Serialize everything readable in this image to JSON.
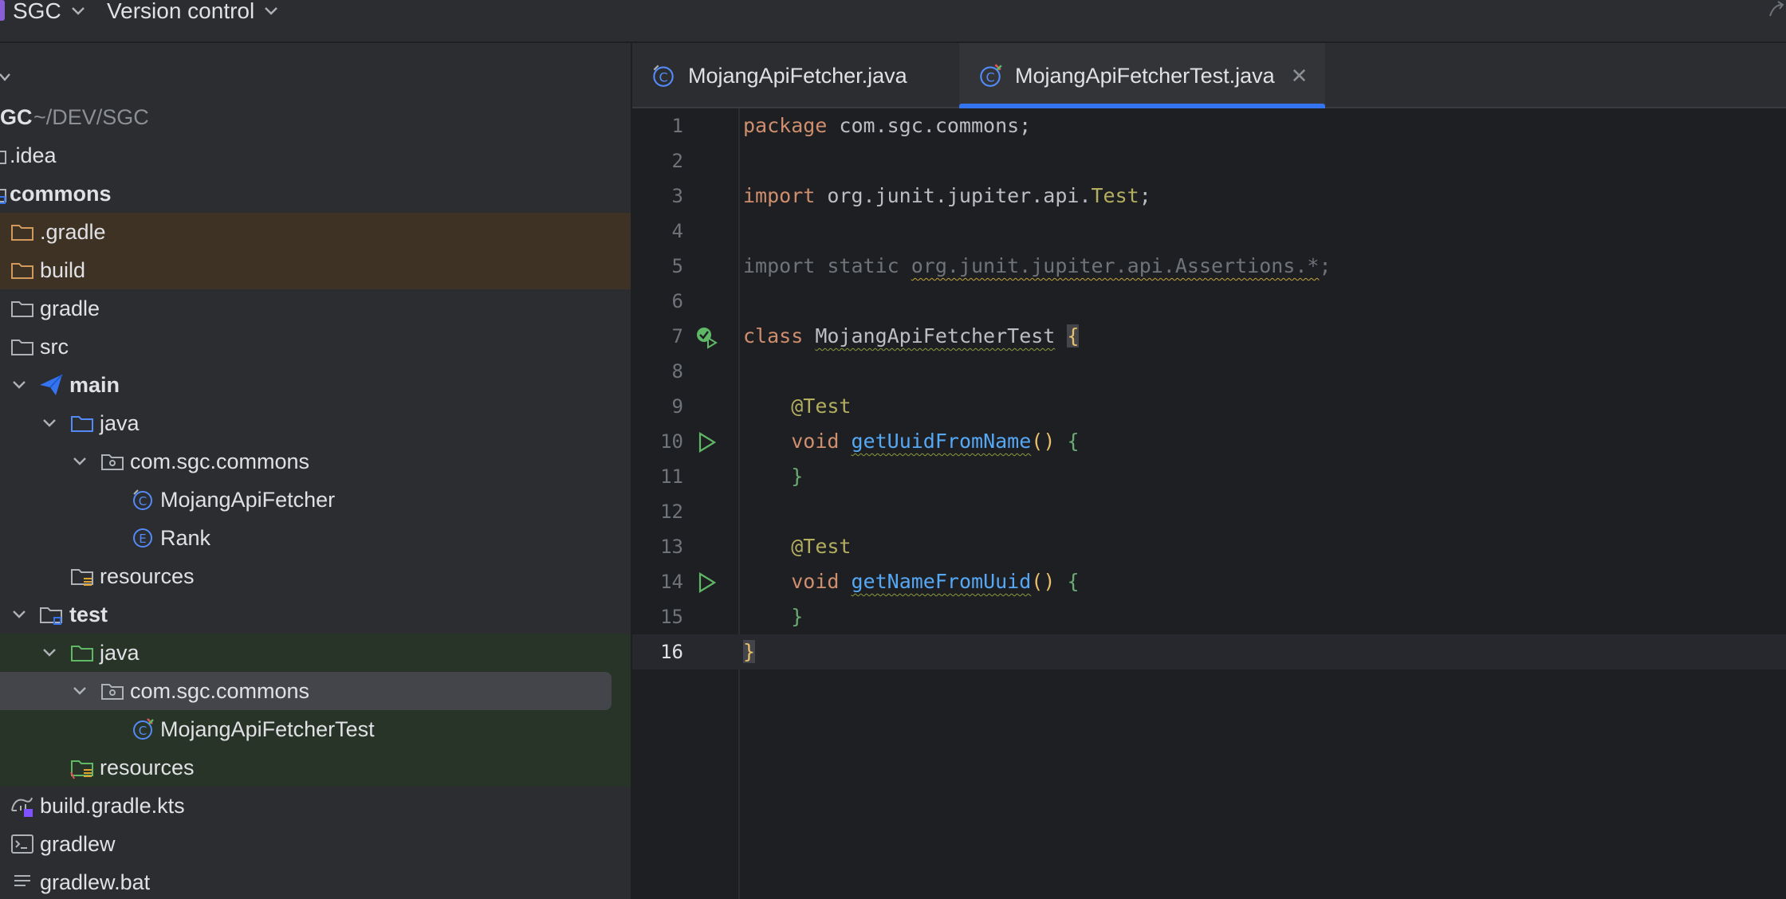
{
  "topbar": {
    "project_name": "SGC",
    "vcs_label": "Version control"
  },
  "project_tree": {
    "root_name": "SGC",
    "root_path": "~/DEV/SGC",
    "items": [
      {
        "label": ".idea"
      },
      {
        "label": "commons"
      },
      {
        "label": ".gradle"
      },
      {
        "label": "build"
      },
      {
        "label": "gradle"
      },
      {
        "label": "src"
      },
      {
        "label": "main"
      },
      {
        "label": "java"
      },
      {
        "label": "com.sgc.commons"
      },
      {
        "label": "MojangApiFetcher"
      },
      {
        "label": "Rank"
      },
      {
        "label": "resources"
      },
      {
        "label": "test"
      },
      {
        "label": "java"
      },
      {
        "label": "com.sgc.commons"
      },
      {
        "label": "MojangApiFetcherTest"
      },
      {
        "label": "resources"
      },
      {
        "label": "build.gradle.kts"
      },
      {
        "label": "gradlew"
      },
      {
        "label": "gradlew.bat"
      }
    ]
  },
  "tabs": [
    {
      "label": "MojangApiFetcher.java",
      "active": false
    },
    {
      "label": "MojangApiFetcherTest.java",
      "active": true
    }
  ],
  "editor": {
    "current_line": 16,
    "line_numbers": [
      "1",
      "2",
      "3",
      "4",
      "5",
      "6",
      "7",
      "8",
      "9",
      "10",
      "11",
      "12",
      "13",
      "14",
      "15",
      "16"
    ],
    "code": {
      "l1_kw": "package",
      "l1_rest": " com.sgc.commons;",
      "l3_kw": "import",
      "l3_rest": " org.junit.jupiter.api.",
      "l3_cls": "Test",
      "l3_end": ";",
      "l5_text": "import static ",
      "l5_pkg": "org.junit.jupiter.api.Assertions.*",
      "l5_end": ";",
      "l7_kw": "class",
      "l7_name": "MojangApiFetcherTest",
      "l7_brace": "{",
      "l9_ann": "@Test",
      "l10_kw": "void",
      "l10_fn": "getUuidFromName",
      "l10_paren": "()",
      "l10_brace": "{",
      "l11_brace": "}",
      "l13_ann": "@Test",
      "l14_kw": "void",
      "l14_fn": "getNameFromUuid",
      "l14_paren": "()",
      "l14_brace": "{",
      "l15_brace": "}",
      "l16_brace": "}"
    }
  },
  "colors": {
    "accent": "#3574f0",
    "keyword": "#cf8e6d",
    "annotation": "#b3ae60",
    "function": "#56a8f5",
    "run_icon": "#5fb865",
    "excluded_bg": "#3d3223",
    "test_bg": "#283427"
  },
  "icons": {
    "class_file": "class-icon",
    "enum_file": "enum-icon",
    "folder": "folder-icon",
    "module": "module-icon",
    "package": "package-icon",
    "run_gutter": "run-icon",
    "test_passed": "test-passed-icon",
    "gradle_script": "gradle-icon",
    "terminal_script": "terminal-file-icon"
  }
}
